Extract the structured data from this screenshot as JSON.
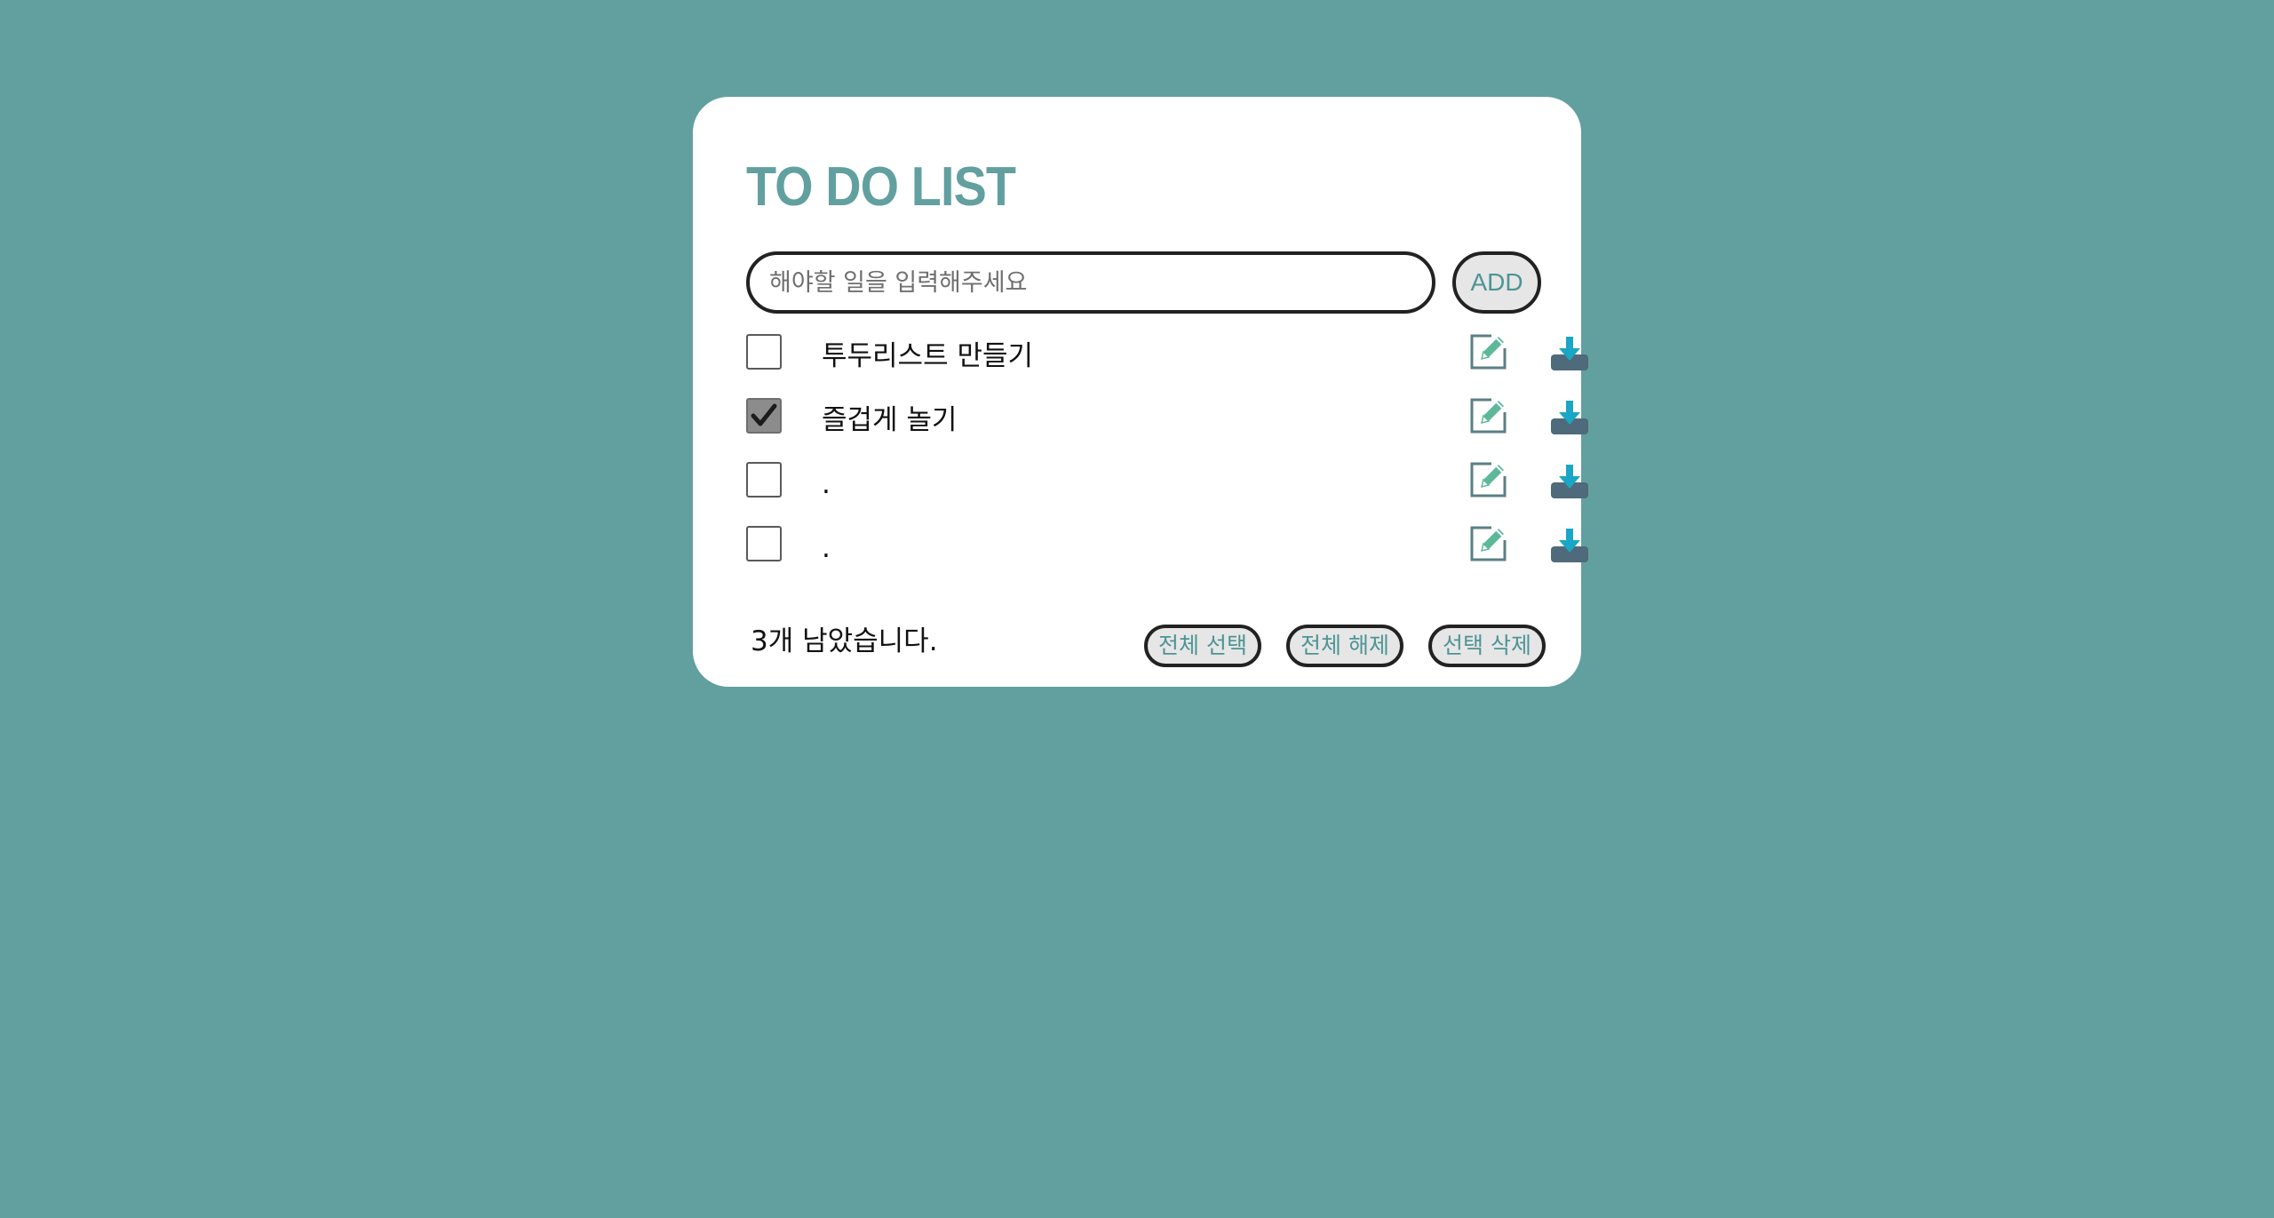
{
  "app": {
    "title": "TO DO LIST"
  },
  "input": {
    "placeholder": "해야할 일을 입력해주세요",
    "value": ""
  },
  "add_button": {
    "label": "ADD"
  },
  "todos": [
    {
      "text": "투두리스트 만들기",
      "checked": false
    },
    {
      "text": "즐겁게 놀기",
      "checked": true
    },
    {
      "text": ".",
      "checked": false
    },
    {
      "text": ".",
      "checked": false
    }
  ],
  "footer": {
    "remaining_text": "3개 남았습니다.",
    "select_all_label": "전체 선택",
    "deselect_all_label": "전체 해제",
    "delete_selected_label": "선택 삭제"
  },
  "icons": {
    "checkbox_check": "check-icon",
    "edit": "pencil-edit-icon",
    "delete": "download-tray-icon"
  },
  "colors": {
    "background": "#62a0a0",
    "card": "#ffffff",
    "accent": "#4e9494",
    "edit_icon": "#5db89a",
    "delete_arrow": "#1aa6c4",
    "delete_tray": "#4f6a7a"
  }
}
